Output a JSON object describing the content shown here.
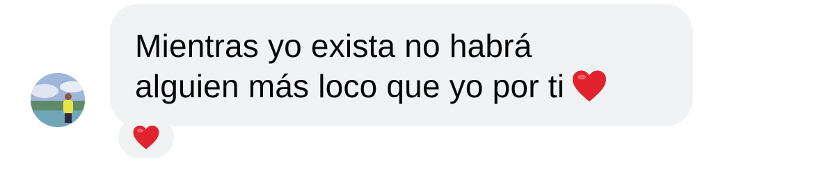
{
  "message": {
    "lines": [
      "Mientras yo exista no habrá",
      "alguien más loco que yo por ti"
    ],
    "inline_emoji": "red-heart-icon"
  },
  "reaction": {
    "emoji": "red-heart-icon"
  },
  "colors": {
    "bubble_bg": "#f1f2f4",
    "text": "#050505",
    "heart": "#e0232e"
  }
}
